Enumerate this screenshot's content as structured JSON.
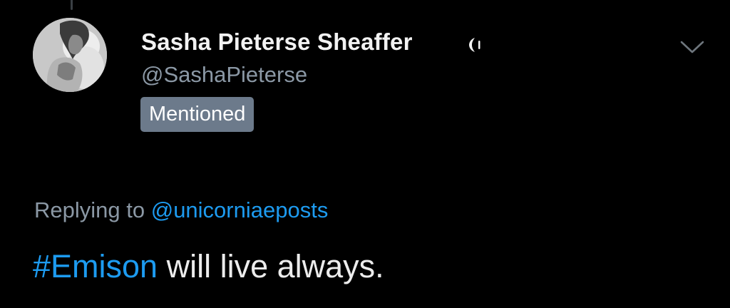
{
  "author": {
    "display_name": "Sasha Pieterse Sheaffer",
    "handle": "@SashaPieterse",
    "badge": "Mentioned"
  },
  "icons": {
    "avatar": "profile-photo",
    "verified": "verified-badge-icon",
    "menu": "chevron-down-icon"
  },
  "reply": {
    "prefix": "Replying to",
    "mention": "@unicorniaeposts"
  },
  "tweet": {
    "hashtag": "#Emison",
    "text": " will live always."
  },
  "colors": {
    "background": "#000000",
    "link": "#1d9bf0",
    "secondary_text": "#8b98a5",
    "badge_bg": "#6c7a8b"
  }
}
